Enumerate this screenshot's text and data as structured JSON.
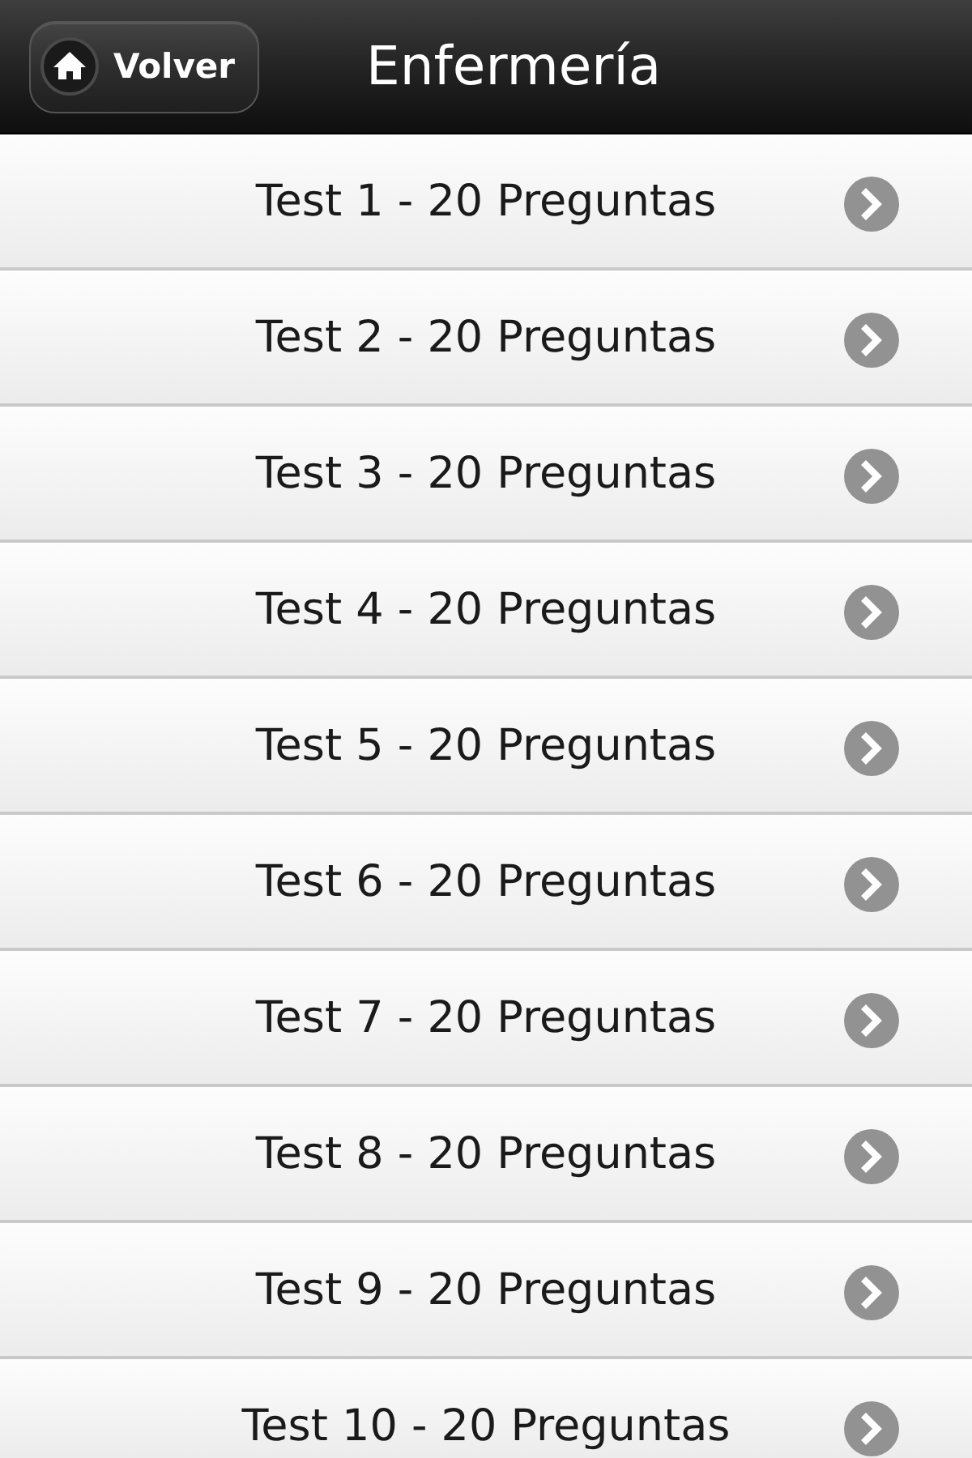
{
  "header": {
    "back_button": {
      "label": "Volver"
    },
    "title": "Enfermería"
  },
  "items": [
    {
      "label": "Test 1 - 20 Preguntas"
    },
    {
      "label": "Test 2 - 20 Preguntas"
    },
    {
      "label": "Test 3 - 20 Preguntas"
    },
    {
      "label": "Test 4 - 20 Preguntas"
    },
    {
      "label": "Test 5 - 20 Preguntas"
    },
    {
      "label": "Test 6 - 20 Preguntas"
    },
    {
      "label": "Test 7 - 20 Preguntas"
    },
    {
      "label": "Test 8 - 20 Preguntas"
    },
    {
      "label": "Test 9 - 20 Preguntas"
    },
    {
      "label": "Test 10 - 20 Preguntas"
    }
  ]
}
